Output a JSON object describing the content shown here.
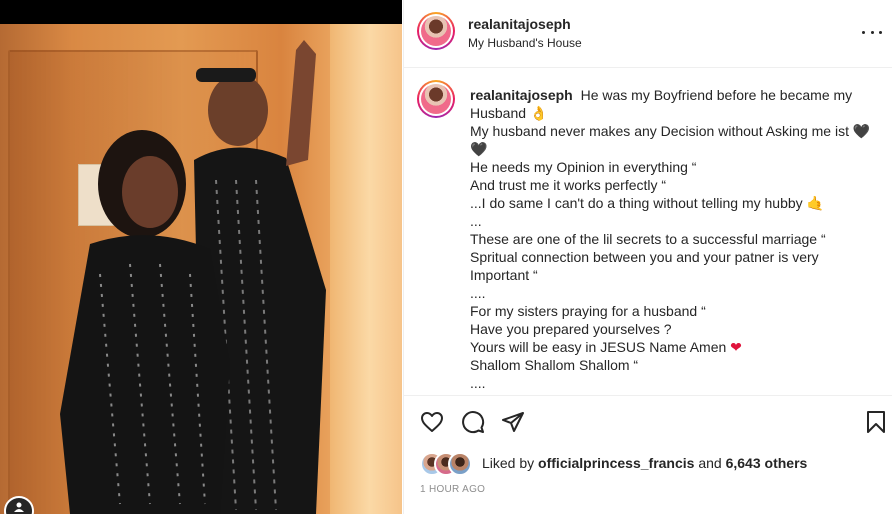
{
  "post": {
    "username": "realanitajoseph",
    "location": "My Husband's House"
  },
  "caption": {
    "username": "realanitajoseph",
    "lines": [
      "He was my Boyfriend before he became my Husband",
      "My husband never makes any Decision without Asking me ist",
      "He needs my Opinion in everything “",
      "And trust me it works perfectly “",
      "...I do same I can't do a thing without telling my hubby",
      "...",
      "These are one of the lil secrets to a successful marriage “",
      "Spritual connection between you and your patner is very Important “",
      "....",
      "For my sisters praying for a husband “",
      "Have you prepared yourselves ?",
      "Yours will be easy in JESUS Name Amen",
      "Shallom Shallom Shallom “",
      "...."
    ],
    "emojis": {
      "ok_hand": "👌",
      "black_heart": "🖤",
      "raised_back_hand": "🤙",
      "red_heart": "❤"
    }
  },
  "actions": {
    "like_icon": "heart-outline-icon",
    "comment_icon": "comment-bubble-icon",
    "share_icon": "paper-plane-icon",
    "save_icon": "bookmark-icon"
  },
  "likes": {
    "prefix": "Liked by",
    "user": "officialprincess_francis",
    "middle": "and",
    "count": "6,643 others"
  },
  "timestamp": "1 HOUR AGO",
  "colors": {
    "text": "#262626",
    "secondary": "#8e8e8e",
    "border": "#efefef",
    "heart_red": "#e0143c"
  }
}
